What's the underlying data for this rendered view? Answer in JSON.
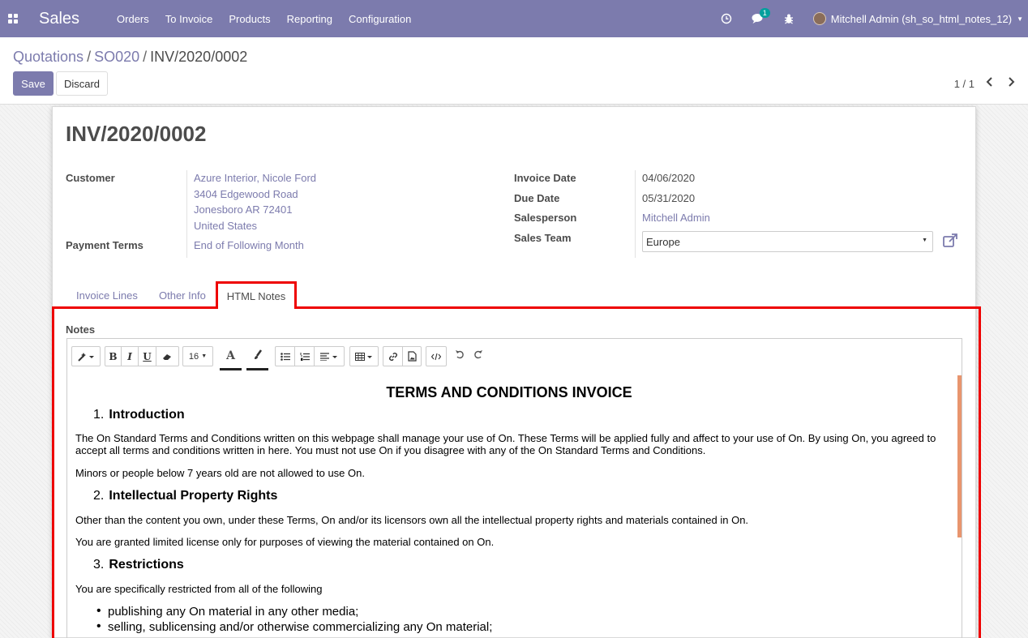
{
  "navbar": {
    "app_name": "Sales",
    "menu": [
      "Orders",
      "To Invoice",
      "Products",
      "Reporting",
      "Configuration"
    ],
    "chat_badge": "1",
    "user": "Mitchell Admin (sh_so_html_notes_12)",
    "bg_color": "#7c7bad"
  },
  "breadcrumb": {
    "items": [
      "Quotations",
      "SO020"
    ],
    "current": "INV/2020/0002",
    "sep": "/"
  },
  "buttons": {
    "save": "Save",
    "discard": "Discard"
  },
  "pager": {
    "text": "1 / 1"
  },
  "record": {
    "title": "INV/2020/0002",
    "customer_label": "Customer",
    "customer_lines": [
      "Azure Interior, Nicole Ford",
      "3404 Edgewood Road",
      "Jonesboro AR 72401",
      "United States"
    ],
    "payment_terms_label": "Payment Terms",
    "payment_terms": "End of Following Month",
    "invoice_date_label": "Invoice Date",
    "invoice_date": "04/06/2020",
    "due_date_label": "Due Date",
    "due_date": "05/31/2020",
    "salesperson_label": "Salesperson",
    "salesperson": "Mitchell Admin",
    "sales_team_label": "Sales Team",
    "sales_team": "Europe"
  },
  "tabs": {
    "invoice_lines": "Invoice Lines",
    "other_info": "Other Info",
    "html_notes": "HTML Notes"
  },
  "notes": {
    "label": "Notes",
    "font_size": "16",
    "title": "TERMS AND CONDITIONS INVOICE",
    "sections": [
      {
        "num": "1.",
        "heading": "Introduction"
      },
      {
        "num": "2.",
        "heading": "Intellectual Property Rights"
      },
      {
        "num": "3.",
        "heading": "Restrictions"
      }
    ],
    "p1": "The On Standard Terms and Conditions written on this webpage shall manage your use of On. These Terms will be applied fully and affect to your use of On. By using On, you agreed to accept all terms and conditions written in here. You must not use On if you disagree with any of the On Standard Terms and Conditions.",
    "p2": "Minors or people below 7 years old are not allowed to use On.",
    "p3": "Other than the content you own, under these Terms, On and/or its licensors own all the intellectual property rights and materials contained in On.",
    "p4": "You are granted limited license only for purposes of viewing the material contained on On.",
    "p5": "You are specifically restricted from all of the following",
    "bullets": [
      "publishing any On material in any other media;",
      "selling, sublicensing and/or otherwise commercializing any On material;"
    ]
  },
  "colors": {
    "accent": "#7c7bad",
    "highlight": "#ee0000",
    "scroll": "#e8956e"
  }
}
